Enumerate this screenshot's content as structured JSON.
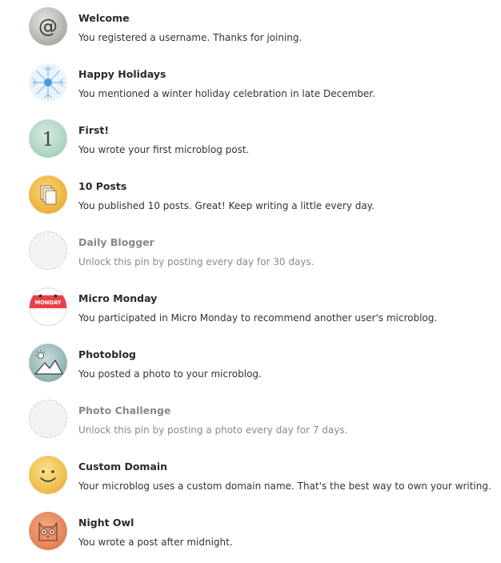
{
  "pins": [
    {
      "title": "Welcome",
      "description": "You registered a username. Thanks for joining.",
      "icon": "at-sign-icon",
      "locked": false
    },
    {
      "title": "Happy Holidays",
      "description": "You mentioned a winter holiday celebration in late December.",
      "icon": "snowflake-icon",
      "locked": false
    },
    {
      "title": "First!",
      "description": "You wrote your first microblog post.",
      "icon": "number-one-icon",
      "locked": false
    },
    {
      "title": "10 Posts",
      "description": "You published 10 posts. Great! Keep writing a little every day.",
      "icon": "stacked-pages-icon",
      "locked": false
    },
    {
      "title": "Daily Blogger",
      "description": "Unlock this pin by posting every day for 30 days.",
      "icon": "locked-pin-placeholder-icon",
      "locked": true
    },
    {
      "title": "Micro Monday",
      "description": "You participated in Micro Monday to recommend another user's microblog.",
      "icon": "calendar-icon",
      "locked": false,
      "icon_text": "MONDAY"
    },
    {
      "title": "Photoblog",
      "description": "You posted a photo to your microblog.",
      "icon": "mountain-sun-icon",
      "locked": false
    },
    {
      "title": "Photo Challenge",
      "description": "Unlock this pin by posting a photo every day for 7 days.",
      "icon": "locked-pin-placeholder-icon",
      "locked": true
    },
    {
      "title": "Custom Domain",
      "description": "Your microblog uses a custom domain name. That's the best way to own your writing.",
      "icon": "smiley-face-icon",
      "locked": false
    },
    {
      "title": "Night Owl",
      "description": "You wrote a post after midnight.",
      "icon": "owl-icon",
      "locked": false
    }
  ],
  "colors": {
    "title_text": "#2a2a2a",
    "description_text": "#333333",
    "locked_text": "#888888",
    "welcome_badge": "#bdbab5",
    "holidays_badge": "#e3f1f8",
    "first_badge": "#b7dbc9",
    "posts_badge": "#f1b93f",
    "monday_red": "#e84046",
    "photoblog_badge": "#8fb6b5",
    "domain_badge": "#f0c24c",
    "owl_badge": "#e98656"
  }
}
